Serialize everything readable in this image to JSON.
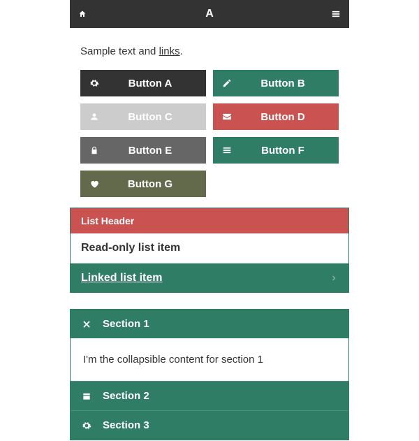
{
  "header": {
    "title": "A"
  },
  "intro": {
    "pre": "Sample text and ",
    "link": "links",
    "post": "."
  },
  "buttons": [
    {
      "label": "Button A",
      "style": "bg-dark",
      "icon": "gear-icon"
    },
    {
      "label": "Button B",
      "style": "bg-green",
      "icon": "edit-icon"
    },
    {
      "label": "Button C",
      "style": "bg-gray",
      "icon": "user-icon"
    },
    {
      "label": "Button D",
      "style": "bg-red",
      "icon": "mail-icon"
    },
    {
      "label": "Button E",
      "style": "bg-medium",
      "icon": "lock-icon"
    },
    {
      "label": "Button F",
      "style": "bg-green",
      "icon": "menu-icon"
    },
    {
      "label": "Button G",
      "style": "bg-olive",
      "icon": "heart-icon"
    }
  ],
  "list": {
    "header": "List Header",
    "readonly": "Read-only list item",
    "linked": "Linked list item"
  },
  "accordion": {
    "s1": {
      "title": "Section 1",
      "content": "I'm the collapsible content for section 1"
    },
    "s2": {
      "title": "Section 2"
    },
    "s3": {
      "title": "Section 3"
    }
  }
}
